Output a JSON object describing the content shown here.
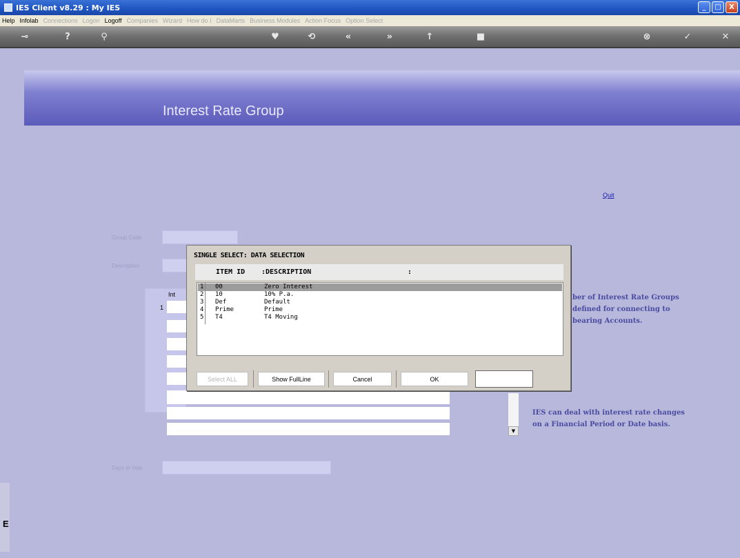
{
  "window": {
    "title": "IES Client v8.29 : My IES",
    "controls": {
      "minimize": "_",
      "maximize": "□",
      "close": "X"
    }
  },
  "menu": {
    "items": [
      {
        "label": "Help",
        "enabled": true
      },
      {
        "label": "Infolab",
        "enabled": true
      },
      {
        "label": "Connections",
        "enabled": false
      },
      {
        "label": "Logon",
        "enabled": false
      },
      {
        "label": "Logoff",
        "enabled": true
      },
      {
        "label": "Companies",
        "enabled": false
      },
      {
        "label": "Wizard",
        "enabled": false
      },
      {
        "label": "How do I",
        "enabled": false
      },
      {
        "label": "DataMarts",
        "enabled": false
      },
      {
        "label": "Business Modules",
        "enabled": false
      },
      {
        "label": "Action Focus",
        "enabled": false
      },
      {
        "label": "Option Select",
        "enabled": false
      }
    ]
  },
  "toolbar": {
    "icons": [
      {
        "name": "key-icon",
        "glyph": "⊸"
      },
      {
        "name": "help-icon",
        "glyph": "?"
      },
      {
        "name": "search-icon",
        "glyph": "⚲"
      },
      {
        "name": "heart-icon",
        "glyph": "♥"
      },
      {
        "name": "refresh-icon",
        "glyph": "⟲"
      },
      {
        "name": "back-icon",
        "glyph": "«"
      },
      {
        "name": "forward-icon",
        "glyph": "»"
      },
      {
        "name": "up-icon",
        "glyph": "↑"
      },
      {
        "name": "stop-icon",
        "glyph": "■"
      },
      {
        "name": "cancel-icon",
        "glyph": "⊗"
      },
      {
        "name": "check-icon",
        "glyph": "✓"
      },
      {
        "name": "close-icon",
        "glyph": "✕"
      }
    ]
  },
  "page": {
    "title": "Interest Rate Group",
    "quit_label": "Quit",
    "group_code_label": "Group Code",
    "description_label": "Description",
    "interest_label": "Int",
    "row_number": "1",
    "days_in_year_label": "Days in Year"
  },
  "info": {
    "line1": "ber of Interest Rate Groups",
    "line2": "defined for connecting to",
    "line3": "bearing Accounts.",
    "line4": "IES can deal with interest rate changes",
    "line5": "on a Financial Period or Date basis."
  },
  "dialog": {
    "title": "SINGLE SELECT: DATA SELECTION",
    "col_id": "ITEM ID",
    "col_desc": ":DESCRIPTION",
    "col_sep": ":",
    "rows": [
      {
        "num": "1",
        "id": "00",
        "desc": "Zero Interest",
        "selected": true
      },
      {
        "num": "2",
        "id": "10",
        "desc": "10% P.a.",
        "selected": false
      },
      {
        "num": "3",
        "id": "Def",
        "desc": "Default",
        "selected": false
      },
      {
        "num": "4",
        "id": "Prime",
        "desc": "Prime",
        "selected": false
      },
      {
        "num": "5",
        "id": "T4",
        "desc": "T4 Moving",
        "selected": false
      }
    ],
    "buttons": {
      "select_all": "Select ALL",
      "show_full_line": "Show FullLine",
      "cancel": "Cancel",
      "ok": "OK"
    }
  },
  "left_strip_char": "E"
}
